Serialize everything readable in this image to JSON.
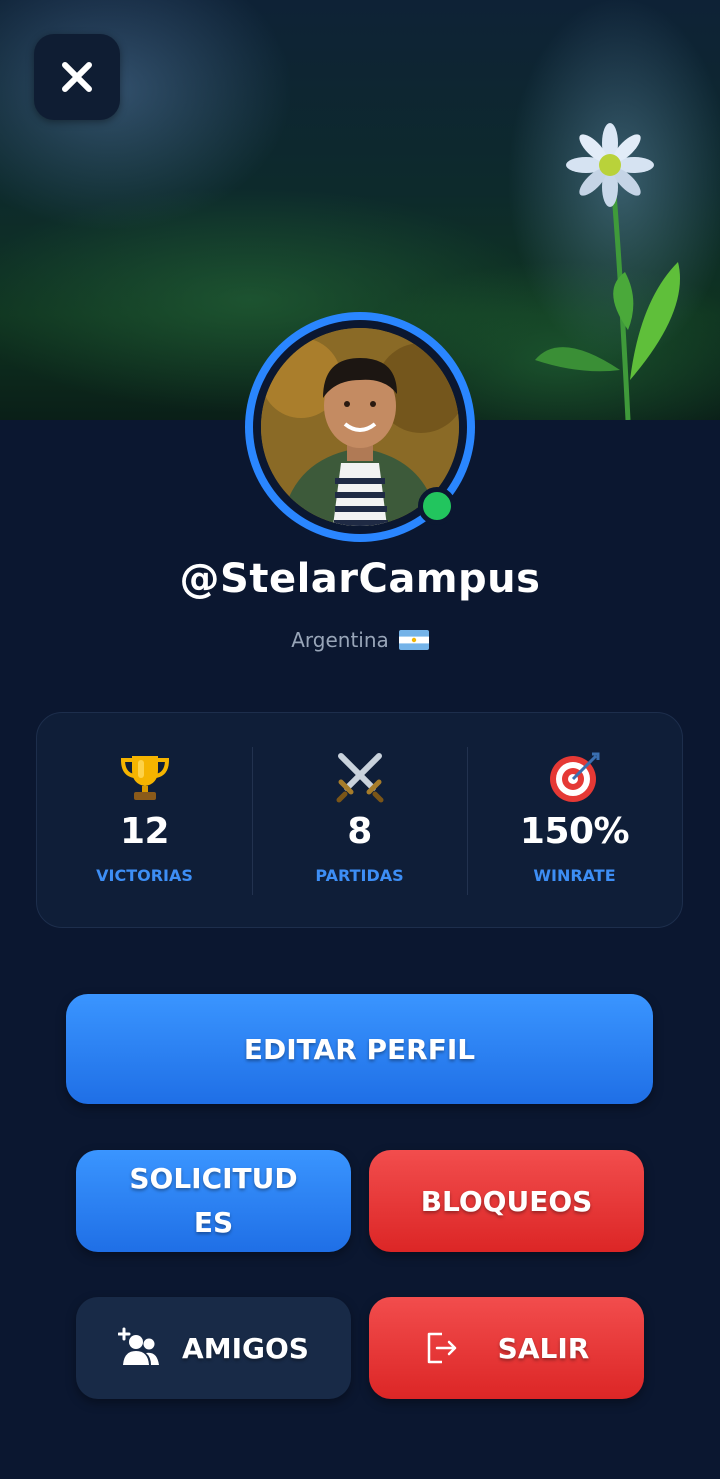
{
  "profile": {
    "username": "@StelarCampus",
    "country": "Argentina",
    "online": true
  },
  "stats": [
    {
      "icon": "trophy-icon",
      "value": "12",
      "label": "VICTORIAS"
    },
    {
      "icon": "crossed-swords-icon",
      "value": "8",
      "label": "PARTIDAS"
    },
    {
      "icon": "target-icon",
      "value": "150%",
      "label": "WINRATE"
    }
  ],
  "actions": {
    "edit_profile": "EDITAR PERFIL",
    "requests": "SOLICITUD ES",
    "requests_line1": "SOLICITUD",
    "requests_line2": "ES",
    "blocks": "BLOQUEOS",
    "friends": "AMIGOS",
    "logout": "SALIR"
  },
  "colors": {
    "background": "#0b1730",
    "accent_blue": "#2a86ff",
    "danger_red": "#e53935",
    "online_green": "#22c55e",
    "stat_label": "#3d8ef5"
  }
}
